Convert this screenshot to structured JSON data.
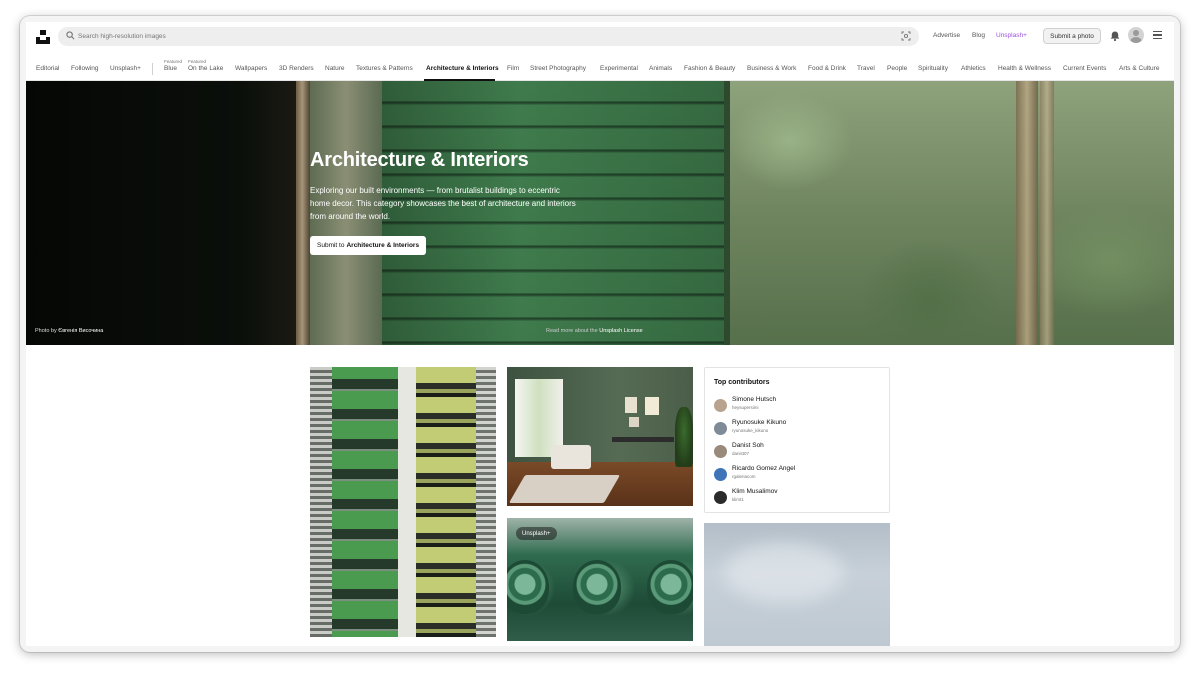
{
  "header": {
    "search_placeholder": "Search high-resolution images",
    "links": [
      "Advertise",
      "Blog",
      "Unsplash+"
    ],
    "submit_label": "Submit a photo"
  },
  "nav": {
    "items": [
      {
        "label": "Editorial"
      },
      {
        "label": "Following"
      },
      {
        "label": "Unsplash+"
      },
      {
        "label": "Blue",
        "featured": "Featured"
      },
      {
        "label": "On the Lake",
        "featured": "Featured"
      },
      {
        "label": "Wallpapers"
      },
      {
        "label": "3D Renders"
      },
      {
        "label": "Nature"
      },
      {
        "label": "Textures & Patterns"
      },
      {
        "label": "Architecture & Interiors",
        "active": true
      },
      {
        "label": "Film"
      },
      {
        "label": "Street Photography"
      },
      {
        "label": "Experimental"
      },
      {
        "label": "Animals"
      },
      {
        "label": "Fashion & Beauty"
      },
      {
        "label": "Business & Work"
      },
      {
        "label": "Food & Drink"
      },
      {
        "label": "Travel"
      },
      {
        "label": "People"
      },
      {
        "label": "Spirituality"
      },
      {
        "label": "Athletics"
      },
      {
        "label": "Health & Wellness"
      },
      {
        "label": "Current Events"
      },
      {
        "label": "Arts & Culture"
      }
    ]
  },
  "hero": {
    "title": "Architecture & Interiors",
    "description": "Exploring our built environments — from brutalist buildings to eccentric home decor. This category showcases the best of architecture and interiors from around the world.",
    "button_prefix": "Submit to",
    "button_topic": "Architecture & Interiors",
    "credit_prefix": "Photo by",
    "credit_name": "Євгенія Височина",
    "license_prefix": "Read more about the",
    "license_link": "Unsplash License"
  },
  "grid": {
    "plus_badge": "Unsplash+"
  },
  "contributors": {
    "title": "Top contributors",
    "items": [
      {
        "name": "Simone Hutsch",
        "username": "heysupersimi",
        "color": "#b9a38f"
      },
      {
        "name": "Ryunosuke Kikuno",
        "username": "ryunosuke_kikuno",
        "color": "#7f8b96"
      },
      {
        "name": "Danist Soh",
        "username": "danist07",
        "color": "#9a8a7c"
      },
      {
        "name": "Ricardo Gomez Angel",
        "username": "rgaleriacom",
        "color": "#3f74b8"
      },
      {
        "name": "Klim Musalimov",
        "username": "klimt1",
        "color": "#2b2b2b"
      }
    ]
  },
  "colors": {
    "accent_plus": "#9b51e0",
    "text_primary": "#111111",
    "text_secondary": "#767676"
  }
}
